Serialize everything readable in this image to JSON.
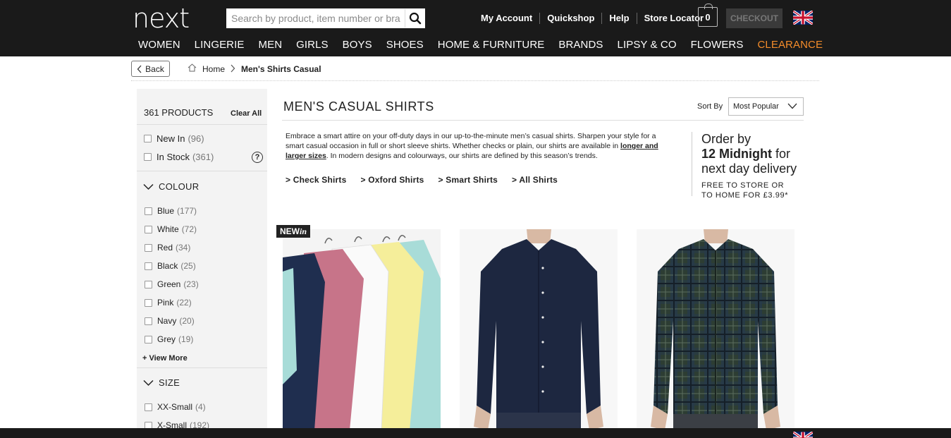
{
  "header": {
    "logo": "next",
    "search_placeholder": "Search by product, item number or brand",
    "top_links": [
      "My Account",
      "Quickshop",
      "Help",
      "Store Locator"
    ],
    "bag_count": "0",
    "checkout_label": "CHECKOUT"
  },
  "nav": {
    "items": [
      "WOMEN",
      "LINGERIE",
      "MEN",
      "GIRLS",
      "BOYS",
      "SHOES",
      "HOME & FURNITURE",
      "BRANDS",
      "LIPSY & CO",
      "FLOWERS",
      "CLEARANCE"
    ]
  },
  "breadcrumb": {
    "back_label": "Back",
    "home_label": "Home",
    "current": "Men's Shirts Casual"
  },
  "sidebar": {
    "product_count": "361 PRODUCTS",
    "clear_all": "Clear All",
    "quick_filters": [
      {
        "label": "New In",
        "count": "(96)"
      },
      {
        "label": "In Stock",
        "count": "(361)"
      }
    ],
    "help_symbol": "?",
    "colour": {
      "heading": "COLOUR",
      "items": [
        {
          "label": "Blue",
          "count": "(177)"
        },
        {
          "label": "White",
          "count": "(72)"
        },
        {
          "label": "Red",
          "count": "(34)"
        },
        {
          "label": "Black",
          "count": "(25)"
        },
        {
          "label": "Green",
          "count": "(23)"
        },
        {
          "label": "Pink",
          "count": "(22)"
        },
        {
          "label": "Navy",
          "count": "(20)"
        },
        {
          "label": "Grey",
          "count": "(19)"
        }
      ],
      "view_more": "+ View More"
    },
    "size": {
      "heading": "SIZE",
      "items": [
        {
          "label": "XX-Small",
          "count": "(4)"
        },
        {
          "label": "X-Small",
          "count": "(192)"
        }
      ]
    }
  },
  "main": {
    "title": "MEN'S CASUAL SHIRTS",
    "sort_label": "Sort By",
    "sort_value": "Most Popular",
    "description_part1": "Embrace a smart attire on your off-duty days in our up-to-the-minute men’s casual shirts. Sharpen your style for a smart casual occasion in full or short sleeve shirts. Whether checks or plain, our shirts are available in ",
    "description_link": "longer and larger sizes",
    "description_part2": ". In modern designs and colourways, our shirts are defined by this season’s trends.",
    "quick_links": [
      "> Check Shirts",
      "> Oxford Shirts",
      "> Smart Shirts",
      "> All Shirts"
    ],
    "promo": {
      "line1": "Order by",
      "line2_bold": "12 Midnight",
      "line2_rest": " for",
      "line3": "next day delivery",
      "line4": "FREE TO STORE OR",
      "line5": "TO HOME FOR £3.99*"
    },
    "new_badge_1": "NEW",
    "new_badge_2": "in"
  },
  "colors": {
    "header_bg": "#1a1a1a",
    "clearance": "#f48c2a",
    "sidebar_bg": "#f3f3f3"
  }
}
